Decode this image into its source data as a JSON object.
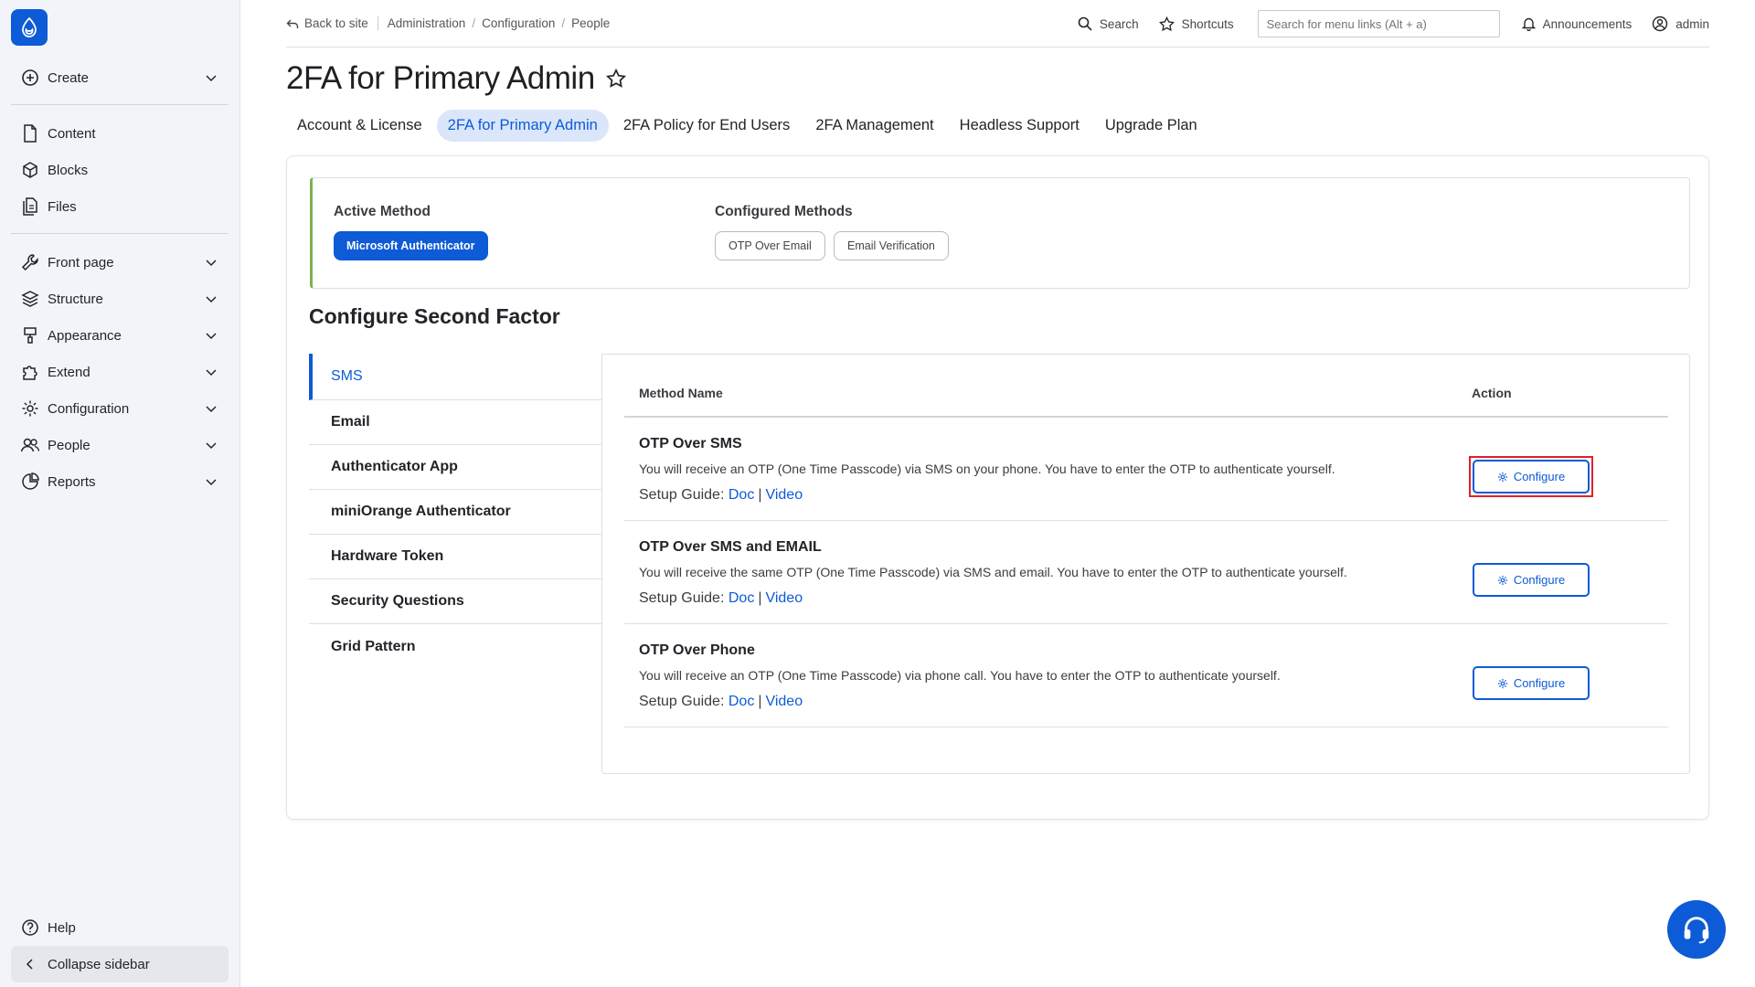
{
  "sidebar": {
    "top_items": [
      {
        "label": "Create",
        "icon": "plus-circle-icon"
      }
    ],
    "content_items": [
      {
        "label": "Content",
        "icon": "file-icon"
      },
      {
        "label": "Blocks",
        "icon": "cube-icon"
      },
      {
        "label": "Files",
        "icon": "files-icon"
      }
    ],
    "nav_items": [
      {
        "label": "Front page",
        "icon": "wrench-icon"
      },
      {
        "label": "Structure",
        "icon": "layers-icon"
      },
      {
        "label": "Appearance",
        "icon": "paint-icon"
      },
      {
        "label": "Extend",
        "icon": "puzzle-icon"
      },
      {
        "label": "Configuration",
        "icon": "gear-icon"
      },
      {
        "label": "People",
        "icon": "people-icon"
      },
      {
        "label": "Reports",
        "icon": "chart-icon"
      }
    ],
    "help_label": "Help",
    "collapse_label": "Collapse sidebar"
  },
  "topbar": {
    "back_label": "Back to site",
    "breadcrumbs": [
      "Administration",
      "Configuration",
      "People"
    ],
    "search_label": "Search",
    "shortcuts_label": "Shortcuts",
    "search_placeholder": "Search for menu links (Alt + a)",
    "announcements_label": "Announcements",
    "user_label": "admin"
  },
  "page": {
    "title": "2FA for Primary Admin",
    "tabs": [
      {
        "label": "Account & License",
        "active": false
      },
      {
        "label": "2FA for Primary Admin",
        "active": true
      },
      {
        "label": "2FA Policy for End Users",
        "active": false
      },
      {
        "label": "2FA Management",
        "active": false
      },
      {
        "label": "Headless Support",
        "active": false
      },
      {
        "label": "Upgrade Plan",
        "active": false
      }
    ]
  },
  "methods": {
    "active_label": "Active Method",
    "active_value": "Microsoft Authenticator",
    "configured_label": "Configured Methods",
    "configured": [
      "OTP Over Email",
      "Email Verification"
    ]
  },
  "second_factor": {
    "title": "Configure Second Factor",
    "categories": [
      "SMS",
      "Email",
      "Authenticator App",
      "miniOrange Authenticator",
      "Hardware Token",
      "Security Questions",
      "Grid Pattern"
    ],
    "active_category": "SMS",
    "col_method": "Method Name",
    "col_action": "Action",
    "rows": [
      {
        "name": "OTP Over SMS",
        "desc": "You will receive an OTP (One Time Passcode) via SMS on your phone. You have to enter the OTP to authenticate yourself.",
        "guide_label": "Setup Guide:",
        "doc": "Doc",
        "video": "Video",
        "button": "Configure"
      },
      {
        "name": "OTP Over SMS and EMAIL",
        "desc": "You will receive the same OTP (One Time Passcode) via SMS and email. You have to enter the OTP to authenticate yourself.",
        "guide_label": "Setup Guide:",
        "doc": "Doc",
        "video": "Video",
        "button": "Configure"
      },
      {
        "name": "OTP Over Phone",
        "desc": "You will receive an OTP (One Time Passcode) via phone call. You have to enter the OTP to authenticate yourself.",
        "guide_label": "Setup Guide:",
        "doc": "Doc",
        "video": "Video",
        "button": "Configure"
      }
    ]
  },
  "colors": {
    "accent": "#0d5bd6",
    "highlight": "#e0212a",
    "active_border": "#7fb050"
  }
}
